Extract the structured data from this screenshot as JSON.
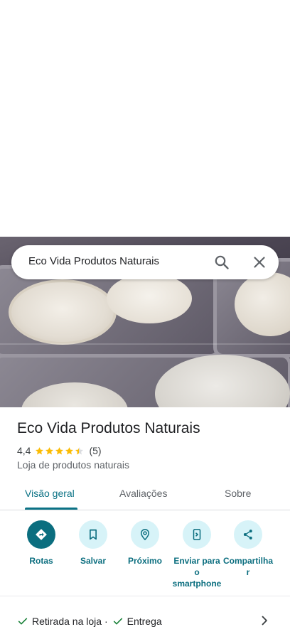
{
  "search": {
    "query": "Eco Vida Produtos Naturais"
  },
  "place": {
    "name": "Eco Vida Produtos Naturais",
    "rating": "4,4",
    "stars": 4.4,
    "review_count": "(5)",
    "category": "Loja de produtos naturais"
  },
  "tabs": [
    {
      "label": "Visão geral",
      "active": true
    },
    {
      "label": "Avaliações",
      "active": false
    },
    {
      "label": "Sobre",
      "active": false
    }
  ],
  "actions": [
    {
      "label": "Rotas",
      "icon": "directions-icon"
    },
    {
      "label": "Salvar",
      "icon": "bookmark-icon"
    },
    {
      "label": "Próximo",
      "icon": "nearby-icon"
    },
    {
      "label": "Enviar para o smartphone",
      "icon": "send-to-phone-icon"
    },
    {
      "label": "Compartilhar",
      "icon": "share-icon"
    }
  ],
  "services": {
    "pickup": "Retirada na loja ·",
    "delivery": "Entrega"
  },
  "colors": {
    "accent": "#0b6e7f",
    "accent_light": "#d7f3f8",
    "star": "#fbbc04",
    "check": "#188038"
  }
}
